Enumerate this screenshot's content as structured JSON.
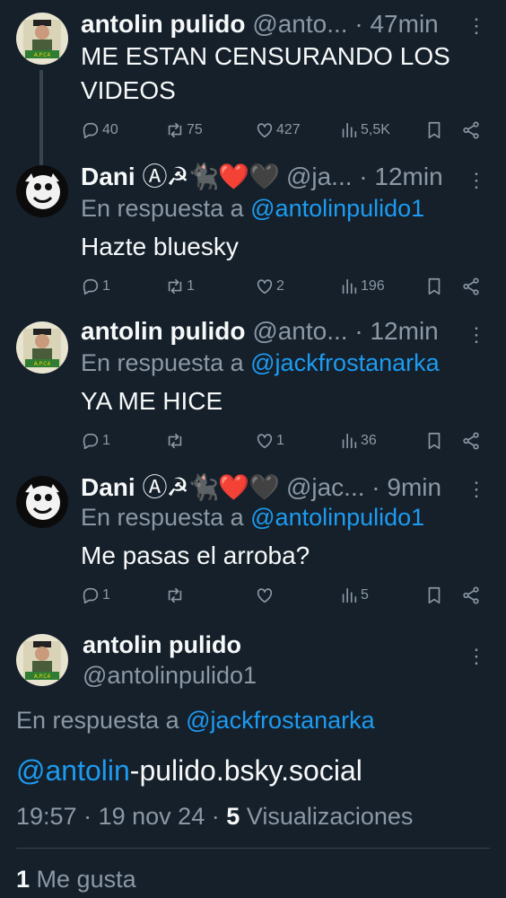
{
  "tweets": [
    {
      "name": "antolin pulido",
      "emoji": "",
      "handle": "@anto...",
      "time": "47min",
      "reply_prefix": "",
      "reply_to": "",
      "text": "ME ESTAN CENSURANDO LOS VIDEOS",
      "stats": {
        "replies": "40",
        "retweets": "75",
        "likes": "427",
        "views": "5,5K"
      }
    },
    {
      "name": "Dani",
      "emoji": "Ⓐ☭🐈‍⬛❤️🖤",
      "handle": "@ja...",
      "time": "12min",
      "reply_prefix": "En respuesta a",
      "reply_to": "@antolinpulido1",
      "text": "Hazte bluesky",
      "stats": {
        "replies": "1",
        "retweets": "1",
        "likes": "2",
        "views": "196"
      }
    },
    {
      "name": "antolin pulido",
      "emoji": "",
      "handle": "@anto...",
      "time": "12min",
      "reply_prefix": "En respuesta a",
      "reply_to": "@jackfrostanarka",
      "text": "YA ME HICE",
      "stats": {
        "replies": "1",
        "retweets": "",
        "likes": "1",
        "views": "36"
      }
    },
    {
      "name": "Dani",
      "emoji": "Ⓐ☭🐈‍⬛❤️🖤",
      "handle": "@jac...",
      "time": "9min",
      "reply_prefix": "En respuesta a",
      "reply_to": "@antolinpulido1",
      "text": "Me pasas el arroba?",
      "stats": {
        "replies": "1",
        "retweets": "",
        "likes": "",
        "views": "5"
      }
    }
  ],
  "separator": "·",
  "main": {
    "name": "antolin pulido",
    "handle": "@antolinpulido1",
    "reply_prefix": "En respuesta a",
    "reply_to": "@jackfrostanarka",
    "text_mention": "@antolin",
    "text_rest": "-pulido.bsky.social",
    "time": "19:57",
    "date": "19 nov 24",
    "views_count": "5",
    "views_label": "Visualizaciones",
    "likes_count": "1",
    "likes_label": "Me gusta"
  },
  "colors": {
    "background": "#15202b",
    "text": "#f7f9f9",
    "muted": "#8b98a5",
    "link": "#1d9bf0",
    "line": "#38444d"
  },
  "icons": [
    "reply-icon",
    "retweet-icon",
    "like-icon",
    "views-icon",
    "bookmark-icon",
    "share-icon",
    "more-icon"
  ]
}
